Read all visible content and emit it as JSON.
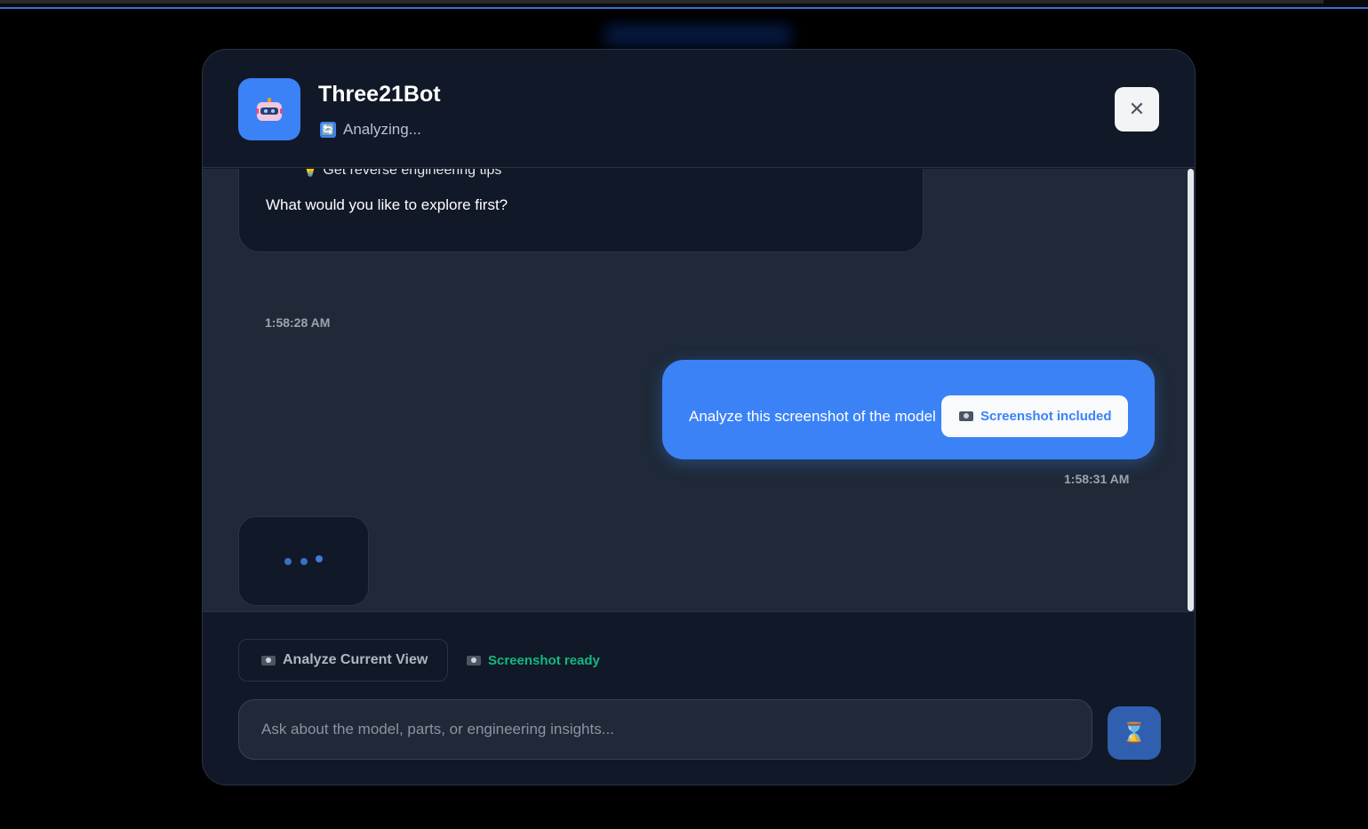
{
  "header": {
    "bot_name": "Three21Bot",
    "status_icon": "🔄",
    "status_text": "Analyzing...",
    "close_icon": "✕"
  },
  "messages": {
    "bot_partial_text": "💡 Get reverse engineering tips",
    "bot_question": "What would you like to explore first?",
    "bot_time": "1:58:28 AM",
    "user_text": "Analyze this screenshot of the model",
    "user_badge": "Screenshot included",
    "user_time": "1:58:31 AM"
  },
  "footer": {
    "analyze_label": "Analyze Current View",
    "ready_label": "Screenshot ready",
    "input_placeholder": "Ask about the model, parts, or engineering insights...",
    "send_icon": "⌛"
  },
  "colors": {
    "accent": "#3b82f6",
    "ready": "#10b981",
    "panel": "#111827",
    "chat_bg": "#1f2937"
  }
}
